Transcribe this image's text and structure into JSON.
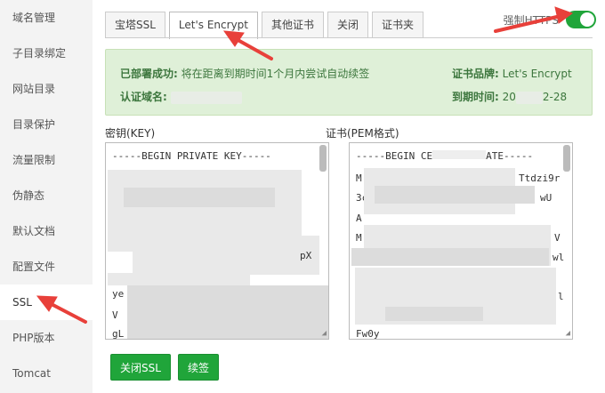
{
  "sidebar": {
    "items": [
      {
        "label": "域名管理"
      },
      {
        "label": "子目录绑定"
      },
      {
        "label": "网站目录"
      },
      {
        "label": "目录保护"
      },
      {
        "label": "流量限制"
      },
      {
        "label": "伪静态"
      },
      {
        "label": "默认文档"
      },
      {
        "label": "配置文件"
      },
      {
        "label": "SSL"
      },
      {
        "label": "PHP版本"
      },
      {
        "label": "Tomcat"
      }
    ]
  },
  "tabs": [
    {
      "label": "宝塔SSL"
    },
    {
      "label": "Let's Encrypt"
    },
    {
      "label": "其他证书"
    },
    {
      "label": "关闭"
    },
    {
      "label": "证书夹"
    }
  ],
  "force_https": {
    "label": "强制HTTPS",
    "enabled": true
  },
  "info": {
    "deploy_status_key": "已部署成功:",
    "deploy_status_val": "将在距离到期时间1个月内尝试自动续签",
    "domain_key": "认证域名:",
    "brand_key": "证书品牌:",
    "brand_val": "Let's Encrypt",
    "expiry_key": "到期时间:",
    "expiry_val_prefix": "20",
    "expiry_val_suffix": "2-28"
  },
  "key_label": "密钥(KEY)",
  "cert_label": "证书(PEM格式)",
  "key_text": {
    "line1": "-----BEGIN PRIVATE KEY-----",
    "line2": "pX",
    "line3": "ye",
    "line4": "V",
    "line5": "gL"
  },
  "cert_text": {
    "line1": "-----BEGIN CE",
    "line1b": "ATE-----",
    "line2a": "M",
    "line2b": "Ttdzi9r",
    "line3a": "3c",
    "line3b": "wU",
    "line4": "A",
    "line5a": "M",
    "line5b": "V",
    "line6": "wl",
    "line7": "l",
    "line8": "Fw0y"
  },
  "buttons": {
    "close_ssl": "关闭SSL",
    "renew": "续签"
  },
  "colors": {
    "accent": "#20a53a",
    "info_bg": "#dff0d8",
    "info_text": "#3c763d",
    "annotation": "#e8403a"
  }
}
